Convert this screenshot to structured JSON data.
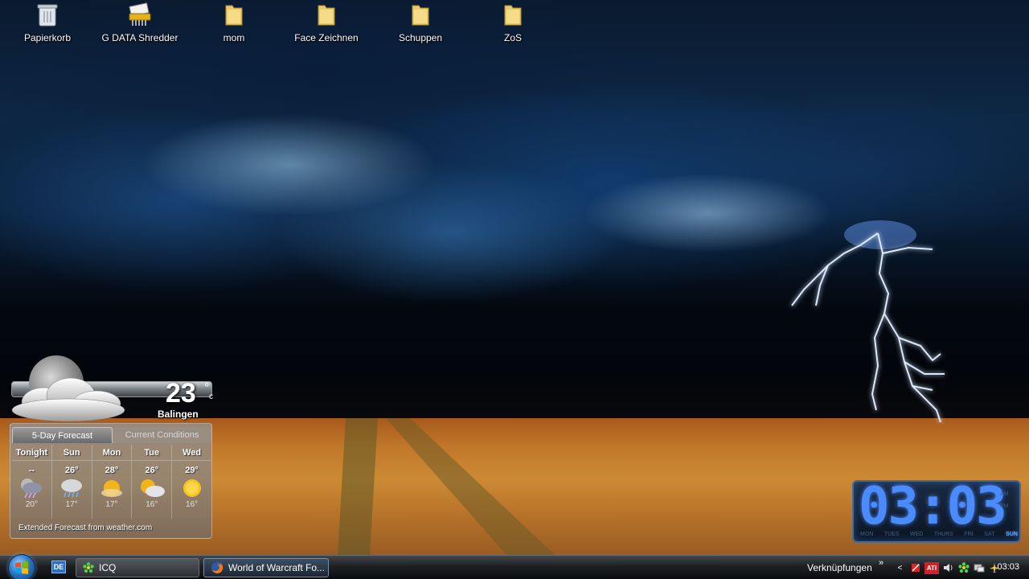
{
  "desktop": {
    "icons": [
      {
        "label": "Papierkorb",
        "icon": "recycle-bin-icon"
      },
      {
        "label": "G DATA Shredder",
        "icon": "shredder-icon"
      },
      {
        "label": "mom",
        "icon": "folder-icon"
      },
      {
        "label": "Face Zeichnen",
        "icon": "folder-icon"
      },
      {
        "label": "Schuppen",
        "icon": "folder-icon"
      },
      {
        "label": "ZoS",
        "icon": "folder-icon"
      }
    ]
  },
  "weather": {
    "temp": "23",
    "degree": "°",
    "unit": "c",
    "city": "Balingen",
    "tabs": [
      "5-Day Forecast",
      "Current Conditions"
    ],
    "days": [
      {
        "name": "Tonight",
        "hi": "--",
        "lo": "20°",
        "icon": "night-thunderstorm-icon"
      },
      {
        "name": "Sun",
        "hi": "26°",
        "lo": "17°",
        "icon": "rain-icon"
      },
      {
        "name": "Mon",
        "hi": "28°",
        "lo": "17°",
        "icon": "partly-sunny-icon"
      },
      {
        "name": "Tue",
        "hi": "26°",
        "lo": "16°",
        "icon": "mostly-cloudy-icon"
      },
      {
        "name": "Wed",
        "hi": "29°",
        "lo": "16°",
        "icon": "sunny-icon"
      }
    ],
    "footer": "Extended Forecast from weather.com"
  },
  "clock": {
    "time": "03:03",
    "am": "AM",
    "pm": "PM",
    "days": [
      "MON",
      "TUES",
      "WED",
      "THURS",
      "FRI",
      "SAT",
      "SUN"
    ],
    "active_day": "SUN"
  },
  "taskbar": {
    "lang": "DE",
    "tasks": [
      {
        "label": "ICQ",
        "icon": "icq-flower-icon"
      },
      {
        "label": "World of Warcraft Fo...",
        "icon": "firefox-icon"
      }
    ],
    "links_label": "Verknüpfungen",
    "links_chevron": "»",
    "tray_arrow": "<",
    "ati_label": "ATI",
    "time": "03:03"
  },
  "colors": {
    "clock_accent": "#4a8cff",
    "taskbar": "#1e2124",
    "field": "#c2792a"
  }
}
